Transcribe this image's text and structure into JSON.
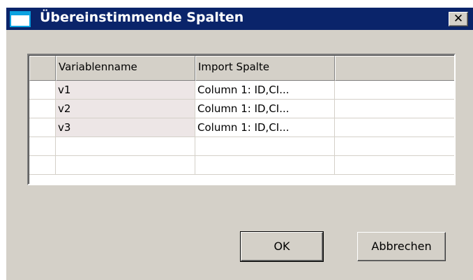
{
  "window": {
    "title": "Übereinstimmende Spalten",
    "close_glyph": "✕"
  },
  "grid": {
    "columns": [
      "",
      "Variablenname",
      "Import Spalte",
      ""
    ],
    "rows": [
      {
        "variable": "v1",
        "import_column": "Column 1: ID,CI...",
        "extra": ""
      },
      {
        "variable": "v2",
        "import_column": "Column 1: ID,CI...",
        "extra": ""
      },
      {
        "variable": "v3",
        "import_column": "Column 1: ID,CI...",
        "extra": ""
      },
      {
        "variable": "",
        "import_column": "",
        "extra": ""
      },
      {
        "variable": "",
        "import_column": "",
        "extra": ""
      }
    ]
  },
  "buttons": {
    "ok_label": "OK",
    "cancel_label": "Abbrechen"
  },
  "colors": {
    "titlebar": "#0a246a",
    "dialog_face": "#d4d0c8",
    "filled_cell": "#ede6e6",
    "icon_accent": "#0aa1e0"
  }
}
